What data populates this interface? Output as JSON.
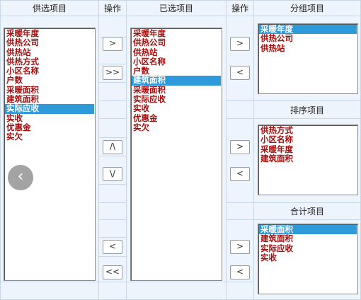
{
  "headers": {
    "available": "供选项目",
    "op1": "操作",
    "selected": "已选项目",
    "op2": "操作",
    "group": "分组项目",
    "sort": "排序项目",
    "total": "合计项目"
  },
  "available_items": [
    {
      "label": "采暖年度",
      "selected": false
    },
    {
      "label": "供热公司",
      "selected": false
    },
    {
      "label": "供热站",
      "selected": false
    },
    {
      "label": "供热方式",
      "selected": false
    },
    {
      "label": "小区名称",
      "selected": false
    },
    {
      "label": "户数",
      "selected": false
    },
    {
      "label": "采暖面积",
      "selected": false
    },
    {
      "label": "建筑面积",
      "selected": false
    },
    {
      "label": "实际应收",
      "selected": true
    },
    {
      "label": "实收",
      "selected": false
    },
    {
      "label": "优惠金",
      "selected": false
    },
    {
      "label": "实欠",
      "selected": false
    }
  ],
  "selected_items": [
    {
      "label": "采暖年度",
      "selected": false
    },
    {
      "label": "供热公司",
      "selected": false
    },
    {
      "label": "供热站",
      "selected": false
    },
    {
      "label": "小区名称",
      "selected": false
    },
    {
      "label": "户数",
      "selected": false
    },
    {
      "label": "建筑面积",
      "selected": true
    },
    {
      "label": "采暖面积",
      "selected": false
    },
    {
      "label": "实际应收",
      "selected": false
    },
    {
      "label": "实收",
      "selected": false
    },
    {
      "label": "优惠金",
      "selected": false
    },
    {
      "label": "实欠",
      "selected": false
    }
  ],
  "group_items": [
    {
      "label": "采暖年度",
      "selected": true
    },
    {
      "label": "供热公司",
      "selected": false
    },
    {
      "label": "供热站",
      "selected": false
    }
  ],
  "sort_items": [
    {
      "label": "供热方式",
      "selected": false
    },
    {
      "label": "小区名称",
      "selected": false
    },
    {
      "label": "采暖年度",
      "selected": false
    },
    {
      "label": "建筑面积",
      "selected": false
    }
  ],
  "total_items": [
    {
      "label": "采暖面积",
      "selected": true
    },
    {
      "label": "建筑面积",
      "selected": false
    },
    {
      "label": "实际应收",
      "selected": false
    },
    {
      "label": "实收",
      "selected": false
    }
  ],
  "buttons": {
    "add": ">",
    "add_all": ">>",
    "move_up": "/\\",
    "move_down": "\\/",
    "remove": "<",
    "remove_all": "<<",
    "group_add": ">",
    "group_remove": "<",
    "sort_add": ">",
    "sort_remove": "<",
    "total_add": ">",
    "total_remove": "<"
  },
  "overlay": {
    "back_glyph": "‹"
  }
}
